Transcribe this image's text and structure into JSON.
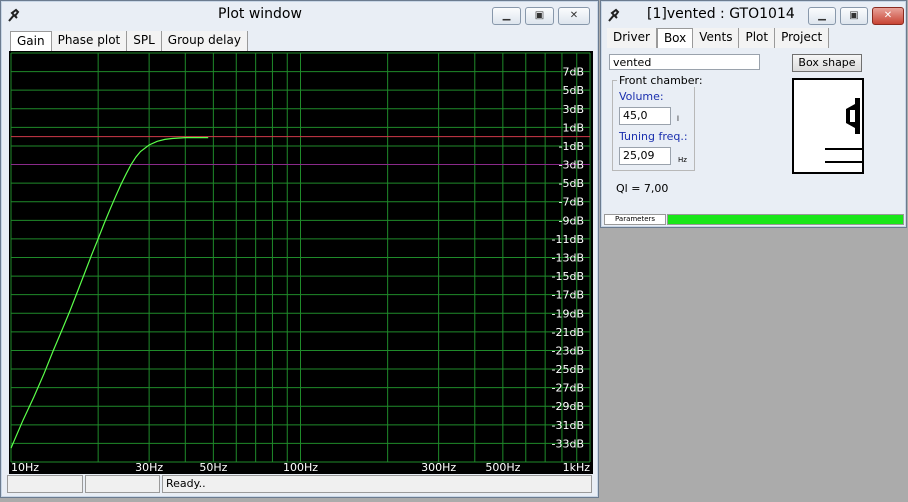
{
  "plot_window": {
    "title": "Plot window",
    "tabs": [
      "Gain",
      "Phase plot",
      "SPL",
      "Group delay"
    ],
    "active_tab": "Gain",
    "status": [
      "",
      "",
      "Ready.."
    ]
  },
  "chart_data": {
    "type": "line",
    "x_scale": "log",
    "xlim": [
      10,
      1000
    ],
    "ylim": [
      -35,
      9
    ],
    "x_tick_labels": [
      "10Hz",
      "30Hz",
      "50Hz",
      "100Hz",
      "300Hz",
      "500Hz",
      "1kHz"
    ],
    "x_tick_values": [
      10,
      30,
      50,
      100,
      300,
      500,
      1000
    ],
    "y_tick_labels": [
      "7dB",
      "5dB",
      "3dB",
      "1dB",
      "-1dB",
      "-3dB",
      "-5dB",
      "-7dB",
      "-9dB",
      "-11dB",
      "-13dB",
      "-15dB",
      "-17dB",
      "-19dB",
      "-21dB",
      "-23dB",
      "-25dB",
      "-27dB",
      "-29dB",
      "-31dB",
      "-33dB"
    ],
    "y_tick_values": [
      7,
      5,
      3,
      1,
      -1,
      -3,
      -5,
      -7,
      -9,
      -11,
      -13,
      -15,
      -17,
      -19,
      -21,
      -23,
      -25,
      -27,
      -29,
      -31,
      -33
    ],
    "grid": true,
    "reference_lines": [
      {
        "y": 0,
        "color": "#d03a4a"
      },
      {
        "y": -3,
        "color": "#8a2a8a"
      }
    ],
    "series": [
      {
        "color": "#5bff4a",
        "x": [
          10,
          11,
          12,
          13,
          14,
          15,
          16,
          17,
          18,
          19,
          20,
          21,
          22,
          23,
          24,
          25,
          26,
          27,
          28,
          30,
          32,
          34,
          36,
          40,
          44,
          48
        ],
        "y": [
          -33.5,
          -30.5,
          -28,
          -25.5,
          -23,
          -20.8,
          -18.7,
          -16.6,
          -14.6,
          -12.7,
          -11,
          -9.3,
          -7.8,
          -6.4,
          -5.1,
          -4,
          -3,
          -2.2,
          -1.6,
          -0.9,
          -0.5,
          -0.3,
          -0.2,
          -0.1,
          -0.1,
          -0.1
        ]
      }
    ]
  },
  "box_window": {
    "title": "[1]vented : GTO1014",
    "tabs": [
      "Driver",
      "Box",
      "Vents",
      "Plot",
      "Project"
    ],
    "active_tab": "Box",
    "box_type_value": "vented",
    "box_shape_label": "Box shape",
    "front_chamber_label": "Front chamber:",
    "volume_label": "Volume:",
    "volume_value": "45,0",
    "volume_unit": "l",
    "tuning_label": "Tuning freq.:",
    "tuning_value": "25,09",
    "tuning_unit": "Hz",
    "ql_text": "Ql = 7,00",
    "parameters_label": "Parameters",
    "progress_fraction": 1.0,
    "progress_color": "#19e619"
  }
}
